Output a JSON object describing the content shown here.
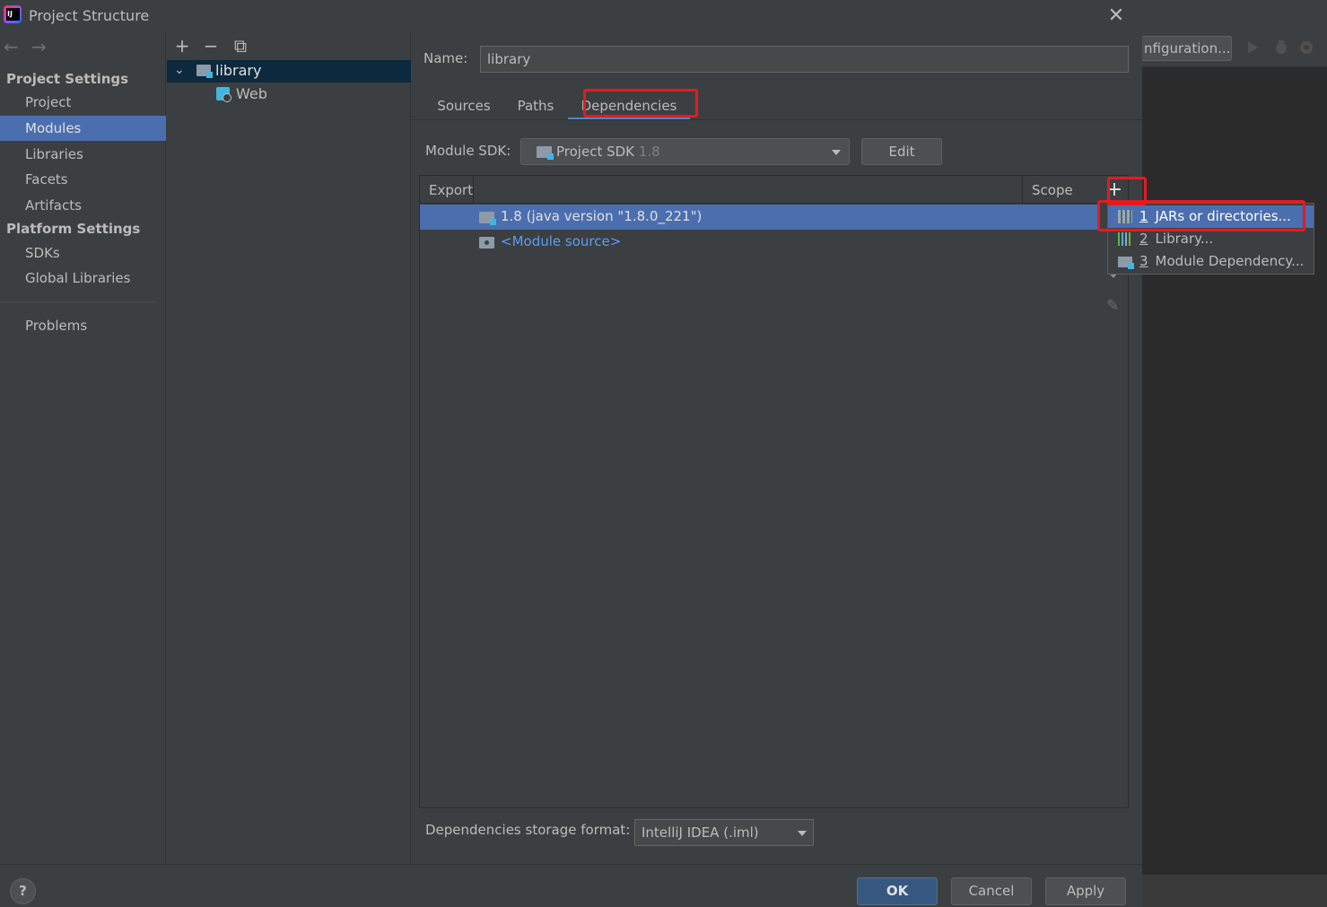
{
  "window": {
    "title": "Project Structure",
    "close_icon": "close-icon",
    "app_icon": "intellij-icon"
  },
  "background_ide": {
    "config_label": "nfiguration..."
  },
  "nav": {
    "project_settings_header": "Project Settings",
    "project_settings_items": [
      "Project",
      "Modules",
      "Libraries",
      "Facets",
      "Artifacts"
    ],
    "platform_settings_header": "Platform Settings",
    "platform_settings_items": [
      "SDKs",
      "Global Libraries"
    ],
    "problems": "Problems",
    "selected": "Modules"
  },
  "tree": {
    "toolbar": {
      "add": "+",
      "remove": "−",
      "copy": "⧉"
    },
    "root": "library",
    "child": "Web"
  },
  "module": {
    "name_label": "Name:",
    "name_value": "library",
    "tabs": [
      "Sources",
      "Paths",
      "Dependencies"
    ],
    "active_tab": "Dependencies",
    "sdk_label": "Module SDK:",
    "sdk_value": "Project SDK",
    "sdk_version": "1.8",
    "edit_label": "Edit"
  },
  "dependencies": {
    "columns": [
      "Export",
      "Scope"
    ],
    "rows": [
      {
        "name": "1.8 (java version \"1.8.0_221\")",
        "selected": true
      },
      {
        "name": "<Module source>",
        "selected": false
      }
    ],
    "add_button": "+"
  },
  "add_popup": {
    "items": [
      {
        "mnemonic": "1",
        "label": "JARs or directories...",
        "icon": "jar-icon",
        "selected": true
      },
      {
        "mnemonic": "2",
        "label": "Library...",
        "icon": "library-icon",
        "selected": false
      },
      {
        "mnemonic": "3",
        "label": "Module Dependency...",
        "icon": "module-dependency-icon",
        "selected": false
      }
    ]
  },
  "storage": {
    "label": "Dependencies storage format:",
    "value": "IntelliJ IDEA (.iml)"
  },
  "buttons": {
    "help": "?",
    "ok": "OK",
    "cancel": "Cancel",
    "apply": "Apply"
  },
  "colors": {
    "selection": "#4b6eaf",
    "annotation": "#e8191f",
    "link": "#589df6"
  }
}
